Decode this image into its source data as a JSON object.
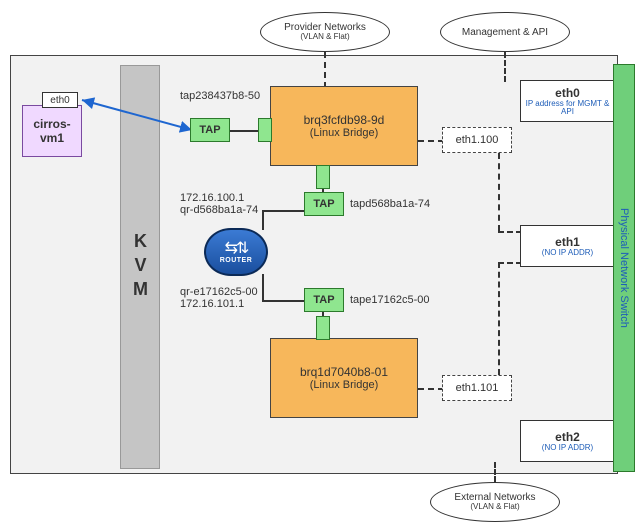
{
  "clouds": {
    "provider": {
      "title": "Provider Networks",
      "sub": "(VLAN & Flat)"
    },
    "mgmt": {
      "title": "Management & API",
      "sub": ""
    },
    "external": {
      "title": "External Networks",
      "sub": "(VLAN & Flat)"
    }
  },
  "kvm": "KVM",
  "vm": {
    "name": "cirros-vm1",
    "iface": "eth0"
  },
  "bridges": {
    "b1": {
      "name": "brq3fcfdb98-9d",
      "sub": "(Linux Bridge)"
    },
    "b2": {
      "name": "brq1d7040b8-01",
      "sub": "(Linux Bridge)"
    }
  },
  "taps": {
    "t1": {
      "label": "TAP",
      "name": "tap238437b8-50"
    },
    "t2": {
      "label": "TAP",
      "name": "tapd568ba1a-74"
    },
    "t3": {
      "label": "TAP",
      "name": "tape17162c5-00"
    }
  },
  "router": {
    "label": "ROUTER",
    "port1": {
      "ip": "172.16.100.1",
      "qr": "qr-d568ba1a-74"
    },
    "port2": {
      "ip": "172.16.101.1",
      "qr": "qr-e17162c5-00"
    }
  },
  "subifaces": {
    "s1": "eth1.100",
    "s2": "eth1.101"
  },
  "nics": {
    "eth0": {
      "name": "eth0",
      "desc": "IP address for MGMT & API"
    },
    "eth1": {
      "name": "eth1",
      "desc": "(NO IP ADDR)"
    },
    "eth2": {
      "name": "eth2",
      "desc": "(NO IP ADDR)"
    }
  },
  "switch": "Physical Network Switch"
}
